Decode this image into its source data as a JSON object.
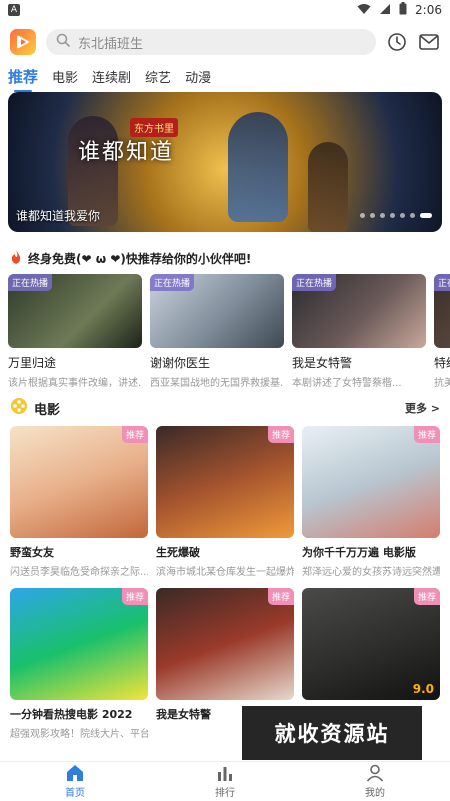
{
  "status": {
    "time": "2:06",
    "notif": "A"
  },
  "search": {
    "placeholder": "东北插班生"
  },
  "tabs": [
    {
      "label": "推荐"
    },
    {
      "label": "电影"
    },
    {
      "label": "连续剧"
    },
    {
      "label": "综艺"
    },
    {
      "label": "动漫"
    }
  ],
  "banner": {
    "caption": "谁都知道我爱你",
    "art_text": "谁都知道",
    "red_badge": "东方书里"
  },
  "promo": {
    "text": "终身免费(❤ ω ❤)快推荐给你的小伙伴吧!"
  },
  "hot": {
    "tag": "正在热播",
    "items": [
      {
        "title": "万里归途",
        "desc": "该片根据真实事件改编，讲述..."
      },
      {
        "title": "谢谢你医生",
        "desc": "西亚某国战地的无国界救援基..."
      },
      {
        "title": "我是女特警",
        "desc": "本剧讲述了女特警蔡楷..."
      },
      {
        "title": "特级",
        "desc": "抗美"
      }
    ]
  },
  "movies": {
    "title": "电影",
    "more": "更多 >",
    "badge": "推荐",
    "items": [
      {
        "title": "野蛮女友",
        "desc": "闪送员李昊临危受命探亲之际..."
      },
      {
        "title": "生死爆破",
        "desc": "滨海市城北某仓库发生一起爆炸..."
      },
      {
        "title": "为你千千万万遍 电影版",
        "desc": "郑泽远心爱的女孩苏诗远突然遭..."
      },
      {
        "title": "一分钟看热搜电影 2022",
        "desc": "超强观影攻略！院线大片、平台..."
      },
      {
        "title": "我是女特警",
        "desc": ""
      },
      {
        "title": "",
        "desc": "",
        "score": "9.0"
      }
    ]
  },
  "watermark": "就收资源站",
  "nav": [
    {
      "label": "首页"
    },
    {
      "label": "排行"
    },
    {
      "label": "我的"
    }
  ]
}
